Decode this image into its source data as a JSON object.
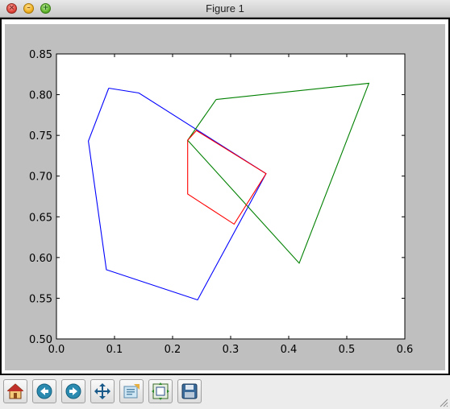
{
  "window": {
    "title": "Figure 1",
    "controls": [
      {
        "name": "close",
        "glyph": "×"
      },
      {
        "name": "minimize",
        "glyph": "–"
      },
      {
        "name": "zoom",
        "glyph": "+"
      }
    ]
  },
  "toolbar": {
    "buttons": [
      {
        "name": "home-button",
        "icon": "home-icon"
      },
      {
        "name": "back-button",
        "icon": "back-arrow-icon"
      },
      {
        "name": "forward-button",
        "icon": "forward-arrow-icon"
      },
      {
        "name": "pan-button",
        "icon": "pan-arrows-icon"
      },
      {
        "name": "zoom-rect-button",
        "icon": "zoom-rect-icon"
      },
      {
        "name": "configure-subplots-button",
        "icon": "subplots-icon"
      },
      {
        "name": "save-button",
        "icon": "save-disk-icon"
      }
    ]
  },
  "chart_data": {
    "type": "line",
    "title": "",
    "xlabel": "",
    "ylabel": "",
    "xlim": [
      0.0,
      0.6
    ],
    "ylim": [
      0.5,
      0.85
    ],
    "xticks": [
      "0.0",
      "0.1",
      "0.2",
      "0.3",
      "0.4",
      "0.5",
      "0.6"
    ],
    "yticks": [
      "0.50",
      "0.55",
      "0.60",
      "0.65",
      "0.70",
      "0.75",
      "0.80",
      "0.85"
    ],
    "grid": false,
    "legend": false,
    "series": [
      {
        "color": "#0000ff",
        "x": [
          0.09,
          0.142,
          0.361,
          0.243,
          0.086,
          0.055,
          0.09
        ],
        "y": [
          0.808,
          0.802,
          0.703,
          0.548,
          0.585,
          0.743,
          0.808
        ]
      },
      {
        "color": "#008000",
        "x": [
          0.275,
          0.538,
          0.418,
          0.226,
          0.275
        ],
        "y": [
          0.794,
          0.814,
          0.593,
          0.744,
          0.794
        ]
      },
      {
        "color": "#ff0000",
        "x": [
          0.226,
          0.241,
          0.361,
          0.306,
          0.226,
          0.226
        ],
        "y": [
          0.744,
          0.756,
          0.703,
          0.641,
          0.678,
          0.744
        ]
      }
    ]
  }
}
